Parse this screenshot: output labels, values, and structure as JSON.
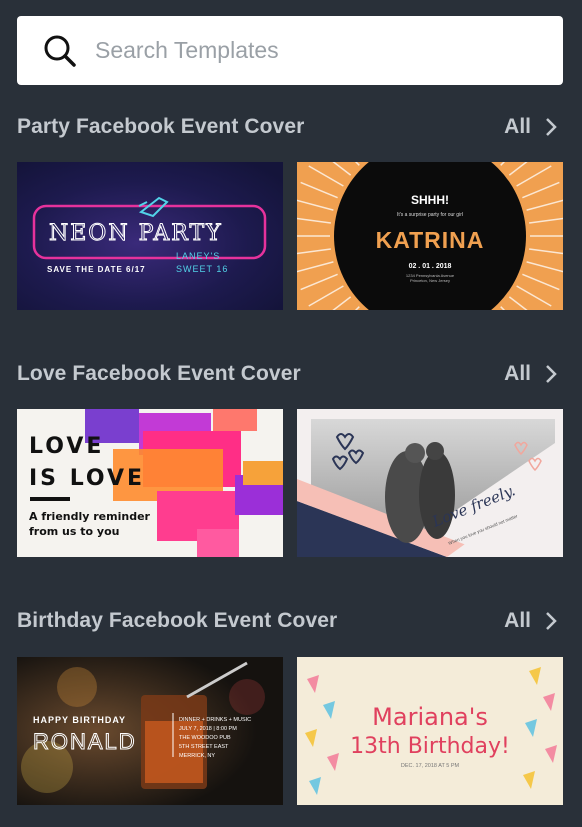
{
  "search": {
    "placeholder": "Search Templates",
    "icon": "search-icon"
  },
  "sections": [
    {
      "title": "Party Facebook Event Cover",
      "all_label": "All",
      "templates": [
        {
          "name": "neon-party",
          "heading": "NEON PARTY",
          "line1": "SAVE THE DATE 6/17",
          "line2": "LANEY'S",
          "line3": "SWEET 16"
        },
        {
          "name": "katrina",
          "top": "SHHH!",
          "sub": "It's a surprise party for our girl",
          "heading": "KATRINA",
          "date": "02 . 01 . 2018",
          "addr1": "1234 Pennsylvania Avenue",
          "addr2": "Princeton, New Jersey"
        }
      ]
    },
    {
      "title": "Love Facebook Event Cover",
      "all_label": "All",
      "templates": [
        {
          "name": "love-is-love",
          "heading1": "LOVE",
          "heading2": "IS LOVE",
          "sub1": "A friendly reminder",
          "sub2": "from us to you"
        },
        {
          "name": "love-freely",
          "script": "Love freely.",
          "sub": "When you love you should not matter"
        }
      ]
    },
    {
      "title": "Birthday Facebook Event Cover",
      "all_label": "All",
      "templates": [
        {
          "name": "ronald",
          "top": "HAPPY BIRTHDAY",
          "heading": "RONALD",
          "d1": "DINNER + DRINKS + MUSIC",
          "d2": "JULY 7, 2018 | 8:00 PM",
          "d3": "THE WOODOO PUB",
          "d4": "5TH STREET EAST",
          "d5": "MERRICK, NY"
        },
        {
          "name": "mariana",
          "line1": "Mariana's",
          "line2": "13th Birthday!",
          "date": "DEC. 17, 2018 AT 5 PM"
        }
      ]
    }
  ],
  "colors": {
    "background": "#293039",
    "section_text": "#c4c9cf",
    "neon_pink": "#e6329c",
    "katrina_orange": "#f0a050",
    "mariana_pink": "#e0405e"
  }
}
